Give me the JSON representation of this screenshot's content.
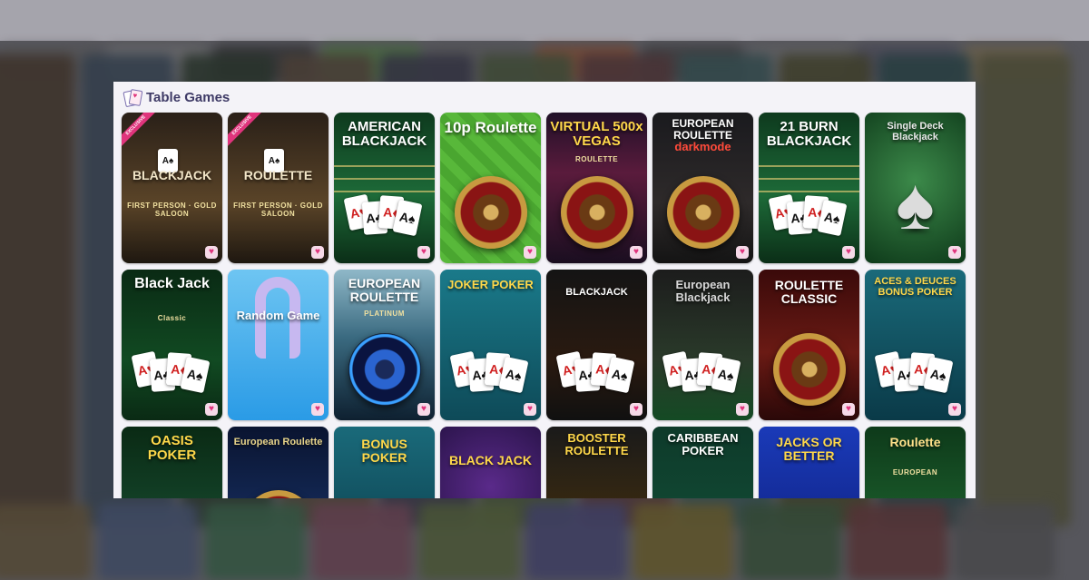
{
  "panel": {
    "title": "Table Games",
    "fav_glyph": "♥",
    "exclusive_label": "EXCLUSIVE"
  },
  "games": [
    {
      "name": "BLACKJACK",
      "sub": "FIRST PERSON · GOLD SALOON",
      "style": "saloon",
      "exclusive": true
    },
    {
      "name": "ROULETTE",
      "sub": "FIRST PERSON · GOLD SALOON",
      "style": "saloon",
      "exclusive": true
    },
    {
      "name": "AMERICAN BLACKJACK",
      "sub": "",
      "style": "green-bj"
    },
    {
      "name": "10p Roulette",
      "sub": "",
      "style": "green-roulette"
    },
    {
      "name": "VIRTUAL 500x VEGAS",
      "sub": "ROULETTE",
      "style": "vegas"
    },
    {
      "name": "EUROPEAN ROULETTE",
      "sub": "darkmode",
      "style": "dark-roulette"
    },
    {
      "name": "21 BURN BLACKJACK",
      "sub": "",
      "style": "green-bj"
    },
    {
      "name": "Single Deck Blackjack",
      "sub": "",
      "style": "spade"
    },
    {
      "name": "Black Jack",
      "sub": "Classic",
      "style": "bj-classic"
    },
    {
      "name": "Random Game",
      "sub": "",
      "style": "random"
    },
    {
      "name": "EUROPEAN ROULETTE",
      "sub": "PLATINUM",
      "style": "platinum"
    },
    {
      "name": "JOKER POKER",
      "sub": "",
      "style": "joker"
    },
    {
      "name": "BLACKJACK",
      "sub": "",
      "style": "black-bj"
    },
    {
      "name": "European Blackjack",
      "sub": "",
      "style": "euro-bj"
    },
    {
      "name": "ROULETTE CLASSIC",
      "sub": "",
      "style": "red-roulette"
    },
    {
      "name": "ACES & DEUCES BONUS POKER",
      "sub": "",
      "style": "teal-poker"
    },
    {
      "name": "OASIS POKER",
      "sub": "",
      "style": "oasis"
    },
    {
      "name": "European Roulette",
      "sub": "",
      "style": "navy-roulette"
    },
    {
      "name": "BONUS POKER",
      "sub": "",
      "style": "teal-poker2"
    },
    {
      "name": "BLACK JACK",
      "sub": "",
      "style": "purple-bj"
    },
    {
      "name": "BOOSTER ROULETTE",
      "sub": "",
      "style": "booster"
    },
    {
      "name": "CARIBBEAN POKER",
      "sub": "",
      "style": "caribbean"
    },
    {
      "name": "JACKS OR BETTER",
      "sub": "",
      "style": "jacks"
    },
    {
      "name": "Roulette",
      "sub": "EUROPEAN",
      "style": "green-euro"
    }
  ]
}
